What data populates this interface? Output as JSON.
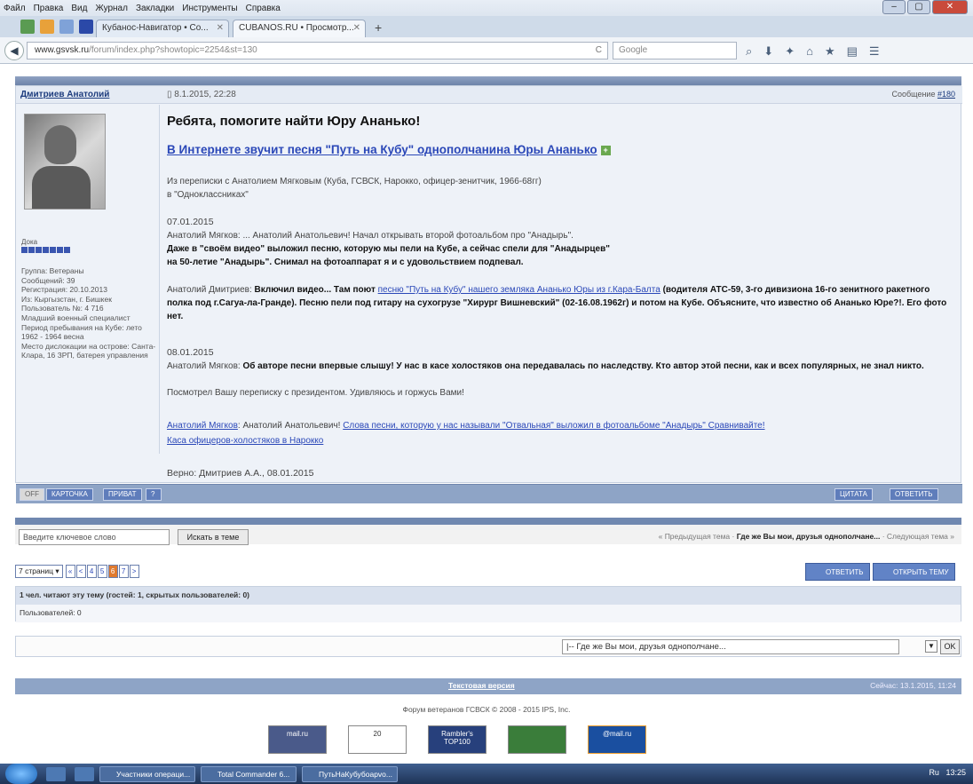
{
  "browser": {
    "menu": [
      "Файл",
      "Правка",
      "Вид",
      "Журнал",
      "Закладки",
      "Инструменты",
      "Справка"
    ],
    "tabs": [
      {
        "label": "Кубанос-Навигатор • Со..."
      },
      {
        "label": "CUBANOS.RU • Просмотр..."
      }
    ],
    "new_tab": "+",
    "url_domain": "www.gsvsk.ru",
    "url_path": "/forum/index.php?showtopic=2254&st=130",
    "search_placeholder": "Google"
  },
  "post": {
    "author": "Дмитриев Анатолий",
    "date": "8.1.2015, 22:28",
    "post_label": "Сообщение",
    "post_number": "#180",
    "title": "Ребята, помогите найти Юру Ананько!",
    "subtitle": "В Интернете звучит песня \"Путь на Кубу\" однополчанина Юры Ананько",
    "intro1": "Из переписки с Анатолием Мягковым (Куба, ГСВСК, Нарокко, офицер-зенитчик, 1966-68гг)",
    "intro2": "в \"Одноклассниках\"",
    "date1": "07.01.2015",
    "m1": "Анатолий Мягков: ... Анатолий Анатольевич! Начал открывать второй фотоальбом про \"Анадырь\".",
    "m1b1": "Даже в \"своём видео\" выложил песню, которую мы пели на Кубе, а сейчас спели для \"Анадырцев\"",
    "m1b2": "на 50-летие \"Анадырь\". Снимал на фотоаппарат я и с удовольствием подпевал.",
    "m2_prefix": "Анатолий Дмитриев: ",
    "m2_bold": "Включил видео... Там поют ",
    "m2_link": "песню \"Путь на Кубу\" нашего земляка Ананько Юры из г.Кара-Балта",
    "m2_rest": " (водителя АТС-59, 3-го дивизиона 16-го зенитного ракетного полка под г.Сагуа-ла-Гранде). Песню пели под гитару на сухогрузе \"Хирург Вишневский\" (02-16.08.1962г) и потом на Кубе. Объясните, что известно об Ананько Юре?!. Его фото нет.",
    "date2": "08.01.2015",
    "m3_prefix": "Анатолий Мягков: ",
    "m3_bold": "Об авторе песни впервые слышу! У нас в касе холостяков она передавалась по наследству. Кто автор этой песни, как и всех популярных, не знал никто.",
    "m4": "Посмотрел Вашу переписку с президентом. Удивляюсь и горжусь Вами!",
    "m5_link1": "Анатолий Мягков",
    "m5_text": ": Анатолий Анатольевич! ",
    "m5_link2": "Слова песни, которую у нас называли \"Отвальная\" выложил в фотоальбоме \"Анадырь\" Сравнивайте!",
    "m5_link3": "Каса офицеров-холостяков в Нарокко",
    "signature": "Верно: Дмитриев А.А., 08.01.2015"
  },
  "profile": {
    "rank": "Дока",
    "group": "Группа: Ветераны",
    "posts": "Сообщений: 39",
    "reg": "Регистрация: 20.10.2013",
    "from": "Из: Кыргызстан, г. Бишкек",
    "user_no": "Пользователь №: 4 716",
    "role": "Младший военный специалист",
    "period": "Период пребывания на Кубе: лето 1962 - 1964 весна",
    "location": "Место дислокации на острове: Санта-Клара, 16 ЗРП, батерея управления"
  },
  "post_footer": {
    "off": "OFF",
    "card": "КАРТОЧКА",
    "private": "ПРИВАТ",
    "quote": "ЦИТАТА",
    "reply": "ОТВЕТИТЬ"
  },
  "search": {
    "placeholder": "Введите ключевое слово",
    "button": "Искать в теме",
    "prev": "« Предыдущая тема · ",
    "topic": "Где же Вы мои, друзья однополчане...",
    "next": " · Следующая тема »"
  },
  "pager": {
    "pages_label": "7 страниц ▾",
    "items": [
      "«",
      "<",
      "4",
      "5",
      "6",
      "7",
      ">"
    ],
    "current": "6",
    "reply_btn": "ОТВЕТИТЬ",
    "newtopic_btn": "ОТКРЫТЬ ТЕМУ"
  },
  "readers": {
    "header": "1 чел. читают эту тему (гостей: 1, скрытых пользователей: 0)",
    "users": "Пользователей: 0"
  },
  "jump": {
    "value": "|-- Где же Вы мои, друзья однополчане...",
    "ok": "OK"
  },
  "footer": {
    "text_version": "Текстовая версия",
    "now": "Сейчас: 13.1.2015, 11:24",
    "copyright": "Форум ветеранов ГСВСК © 2008 - 2015 IPS, Inc."
  },
  "badges": [
    "mail.ru",
    "20",
    "Rambler's TOP100",
    "",
    "@mail.ru"
  ],
  "taskbar": {
    "items": [
      "Участники операци...",
      "Total Commander 6...",
      "ПутьНаКубубоарvo..."
    ],
    "lang": "Ru",
    "time": "13:25"
  }
}
